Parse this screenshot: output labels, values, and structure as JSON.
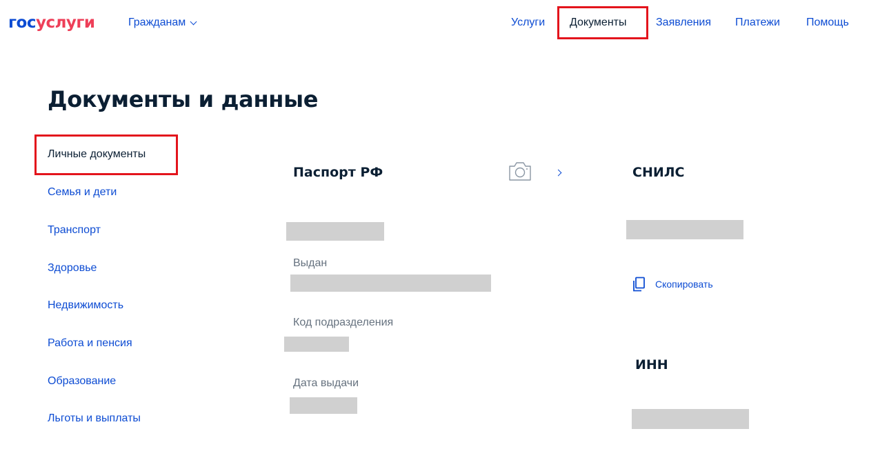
{
  "header": {
    "logo": {
      "part1": "гос",
      "part2": "услуги"
    },
    "citizens_menu": "Гражданам",
    "nav": {
      "services": "Услуги",
      "documents": "Документы",
      "applications": "Заявления",
      "payments": "Платежи",
      "help": "Помощь"
    },
    "active_nav": "Документы"
  },
  "page": {
    "title": "Документы и данные"
  },
  "sidebar": {
    "items": [
      {
        "label": "Личные документы",
        "active": true
      },
      {
        "label": "Семья и дети",
        "active": false
      },
      {
        "label": "Транспорт",
        "active": false
      },
      {
        "label": "Здоровье",
        "active": false
      },
      {
        "label": "Недвижимость",
        "active": false
      },
      {
        "label": "Работа и пенсия",
        "active": false
      },
      {
        "label": "Образование",
        "active": false
      },
      {
        "label": "Льготы и выплаты",
        "active": false
      }
    ]
  },
  "passport": {
    "title": "Паспорт РФ",
    "issued_label": "Выдан",
    "division_code_label": "Код подразделения",
    "issue_date_label": "Дата выдачи"
  },
  "snils": {
    "title": "СНИЛС",
    "copy_label": "Скопировать"
  },
  "inn": {
    "title": "ИНН"
  },
  "icons": {
    "camera": "camera-icon",
    "chevron_right": "chevron-right-icon",
    "chevron_down": "chevron-down-icon",
    "copy": "copy-icon"
  },
  "colors": {
    "link_blue": "#0d4cd3",
    "brand_red": "#ee3f58",
    "text_dark": "#0b1f33",
    "label_gray": "#66727f",
    "highlight_red": "#e3141c",
    "redaction_gray": "#d0d0d0"
  }
}
